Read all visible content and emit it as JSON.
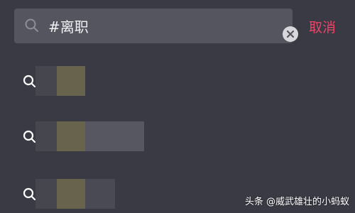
{
  "search": {
    "query": "#离职",
    "cancel_label": "取消"
  },
  "suggestions": [
    {
      "icon": "search-icon",
      "text": ""
    },
    {
      "icon": "search-icon",
      "text": ""
    },
    {
      "icon": "search-icon",
      "text": ""
    }
  ],
  "watermark": "头条 @威武雄壮的小蚂蚁",
  "colors": {
    "background": "#3a3a44",
    "search_field": "#55555f",
    "accent": "#e8456a"
  }
}
